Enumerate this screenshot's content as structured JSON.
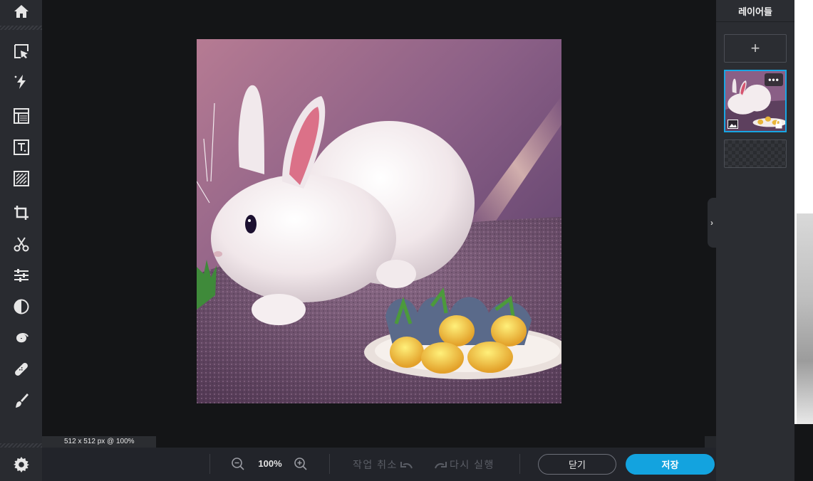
{
  "toolbar": {
    "tools": [
      {
        "name": "home-icon"
      },
      {
        "name": "select-arrange-icon"
      },
      {
        "name": "auto-fix-icon"
      },
      {
        "name": "layout-icon"
      },
      {
        "name": "text-icon"
      },
      {
        "name": "texture-icon"
      },
      {
        "name": "crop-icon"
      },
      {
        "name": "cutout-icon"
      },
      {
        "name": "adjust-icon"
      },
      {
        "name": "filter-icon"
      },
      {
        "name": "liquify-icon"
      },
      {
        "name": "retouch-icon"
      },
      {
        "name": "draw-icon"
      },
      {
        "name": "settings-icon"
      }
    ]
  },
  "canvas": {
    "size_info": "512 x 512 px @ 100%",
    "image_description": "white rabbit with plate of food"
  },
  "bottombar": {
    "zoom_value": "100%",
    "undo_label": "작업 취소",
    "redo_label": "다시 실행",
    "close_label": "닫기",
    "save_label": "저장"
  },
  "layers": {
    "title": "레이어들",
    "add_label": "+",
    "menu_label": "•••",
    "collapse_label": "›"
  },
  "colors": {
    "accent": "#13a3df",
    "panel": "#2b2d32",
    "toolbar": "#292b30",
    "canvas_bg": "#141517"
  }
}
